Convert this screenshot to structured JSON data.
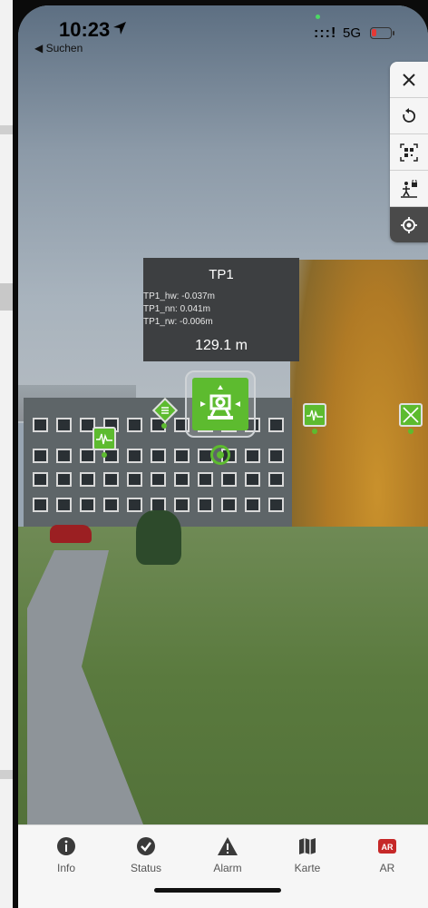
{
  "status_bar": {
    "time": "10:23",
    "back_label": "◀ Suchen",
    "signal": ":::!",
    "network": "5G"
  },
  "toolbar": {
    "icons": [
      "close-icon",
      "rotate-icon",
      "qr-code-icon",
      "person-lock-icon",
      "locate-icon"
    ]
  },
  "panel": {
    "title": "TP1",
    "values": [
      "TP1_hw: -0.037m",
      "TP1_nn: 0.041m",
      "TP1_rw: -0.006m"
    ],
    "distance": "129.1 m"
  },
  "tabs": [
    {
      "label": "Info",
      "icon": "info-icon"
    },
    {
      "label": "Status",
      "icon": "check-icon"
    },
    {
      "label": "Alarm",
      "icon": "alarm-icon"
    },
    {
      "label": "Karte",
      "icon": "map-icon"
    },
    {
      "label": "AR",
      "icon": "ar-icon"
    }
  ],
  "colors": {
    "marker_green": "#5dbb2f",
    "ar_accent": "#c62828"
  }
}
